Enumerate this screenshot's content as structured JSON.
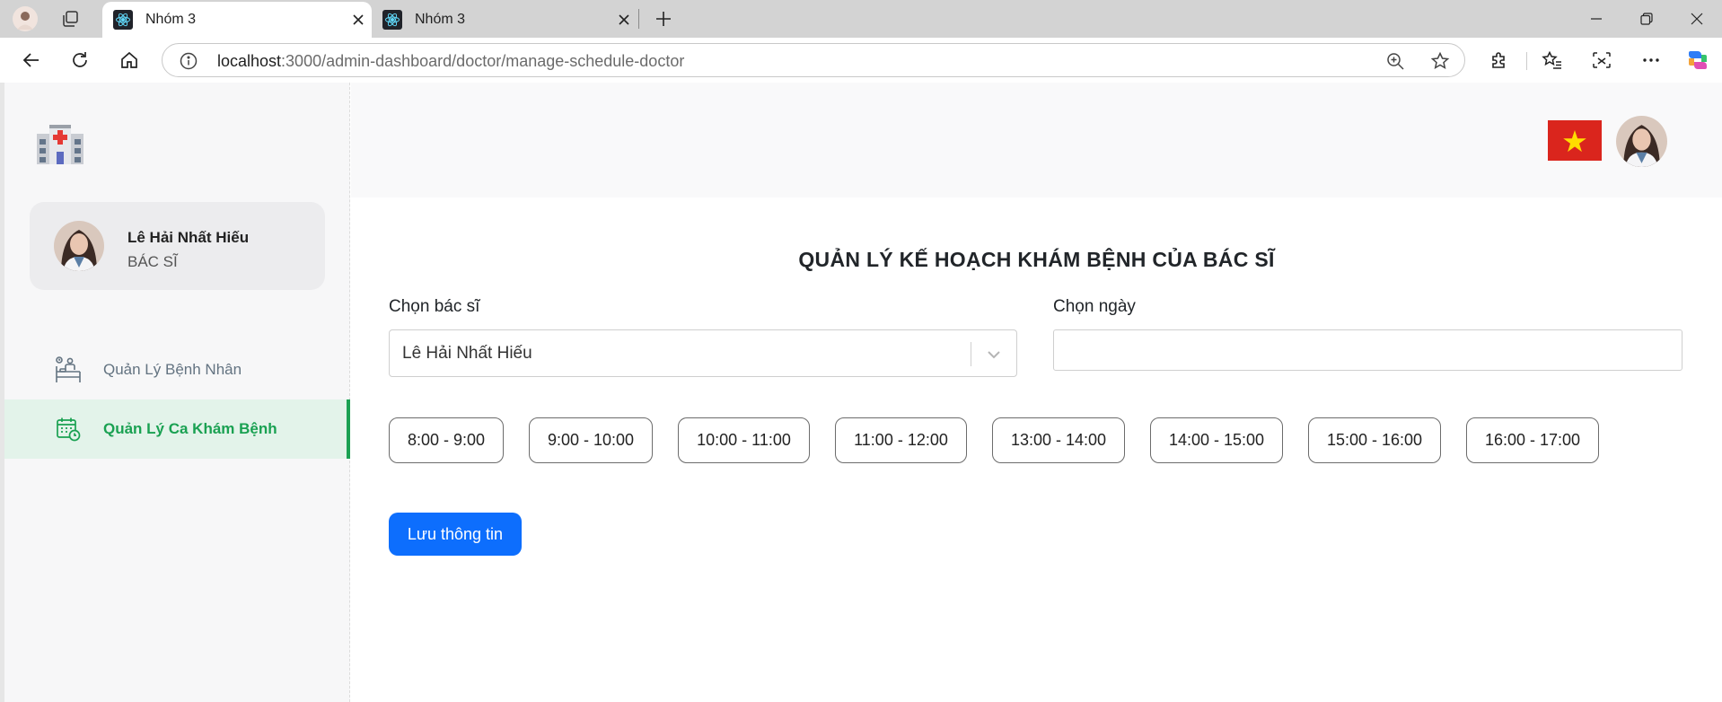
{
  "browser": {
    "tabs": [
      {
        "title": "Nhóm 3",
        "active": true
      },
      {
        "title": "Nhóm 3",
        "active": false
      }
    ],
    "address": {
      "host": "localhost",
      "path": ":3000/admin-dashboard/doctor/manage-schedule-doctor"
    }
  },
  "sidebar": {
    "user": {
      "name": "Lê Hải Nhất Hiếu",
      "role": "BÁC SĨ"
    },
    "items": [
      {
        "label": "Quản Lý Bệnh Nhân",
        "icon": "patient-bed-icon",
        "active": false
      },
      {
        "label": "Quản Lý Ca Khám Bệnh",
        "icon": "calendar-schedule-icon",
        "active": true
      }
    ]
  },
  "header": {
    "language_flag": "vietnam-flag-icon"
  },
  "main": {
    "title": "QUẢN LÝ KẾ HOẠCH KHÁM BỆNH CỦA BÁC SĨ",
    "doctor_label": "Chọn bác sĩ",
    "doctor_value": "Lê Hải Nhất Hiếu",
    "date_label": "Chọn ngày",
    "date_value": "",
    "time_slots": [
      "8:00 - 9:00",
      "9:00 - 10:00",
      "10:00 - 11:00",
      "11:00 - 12:00",
      "13:00 - 14:00",
      "14:00 - 15:00",
      "15:00 - 16:00",
      "16:00 - 17:00"
    ],
    "save_label": "Lưu thông tin"
  },
  "colors": {
    "accent_green": "#1aa152",
    "primary_blue": "#0d6efd",
    "flag_red": "#da251d",
    "flag_star": "#ffdd00"
  }
}
